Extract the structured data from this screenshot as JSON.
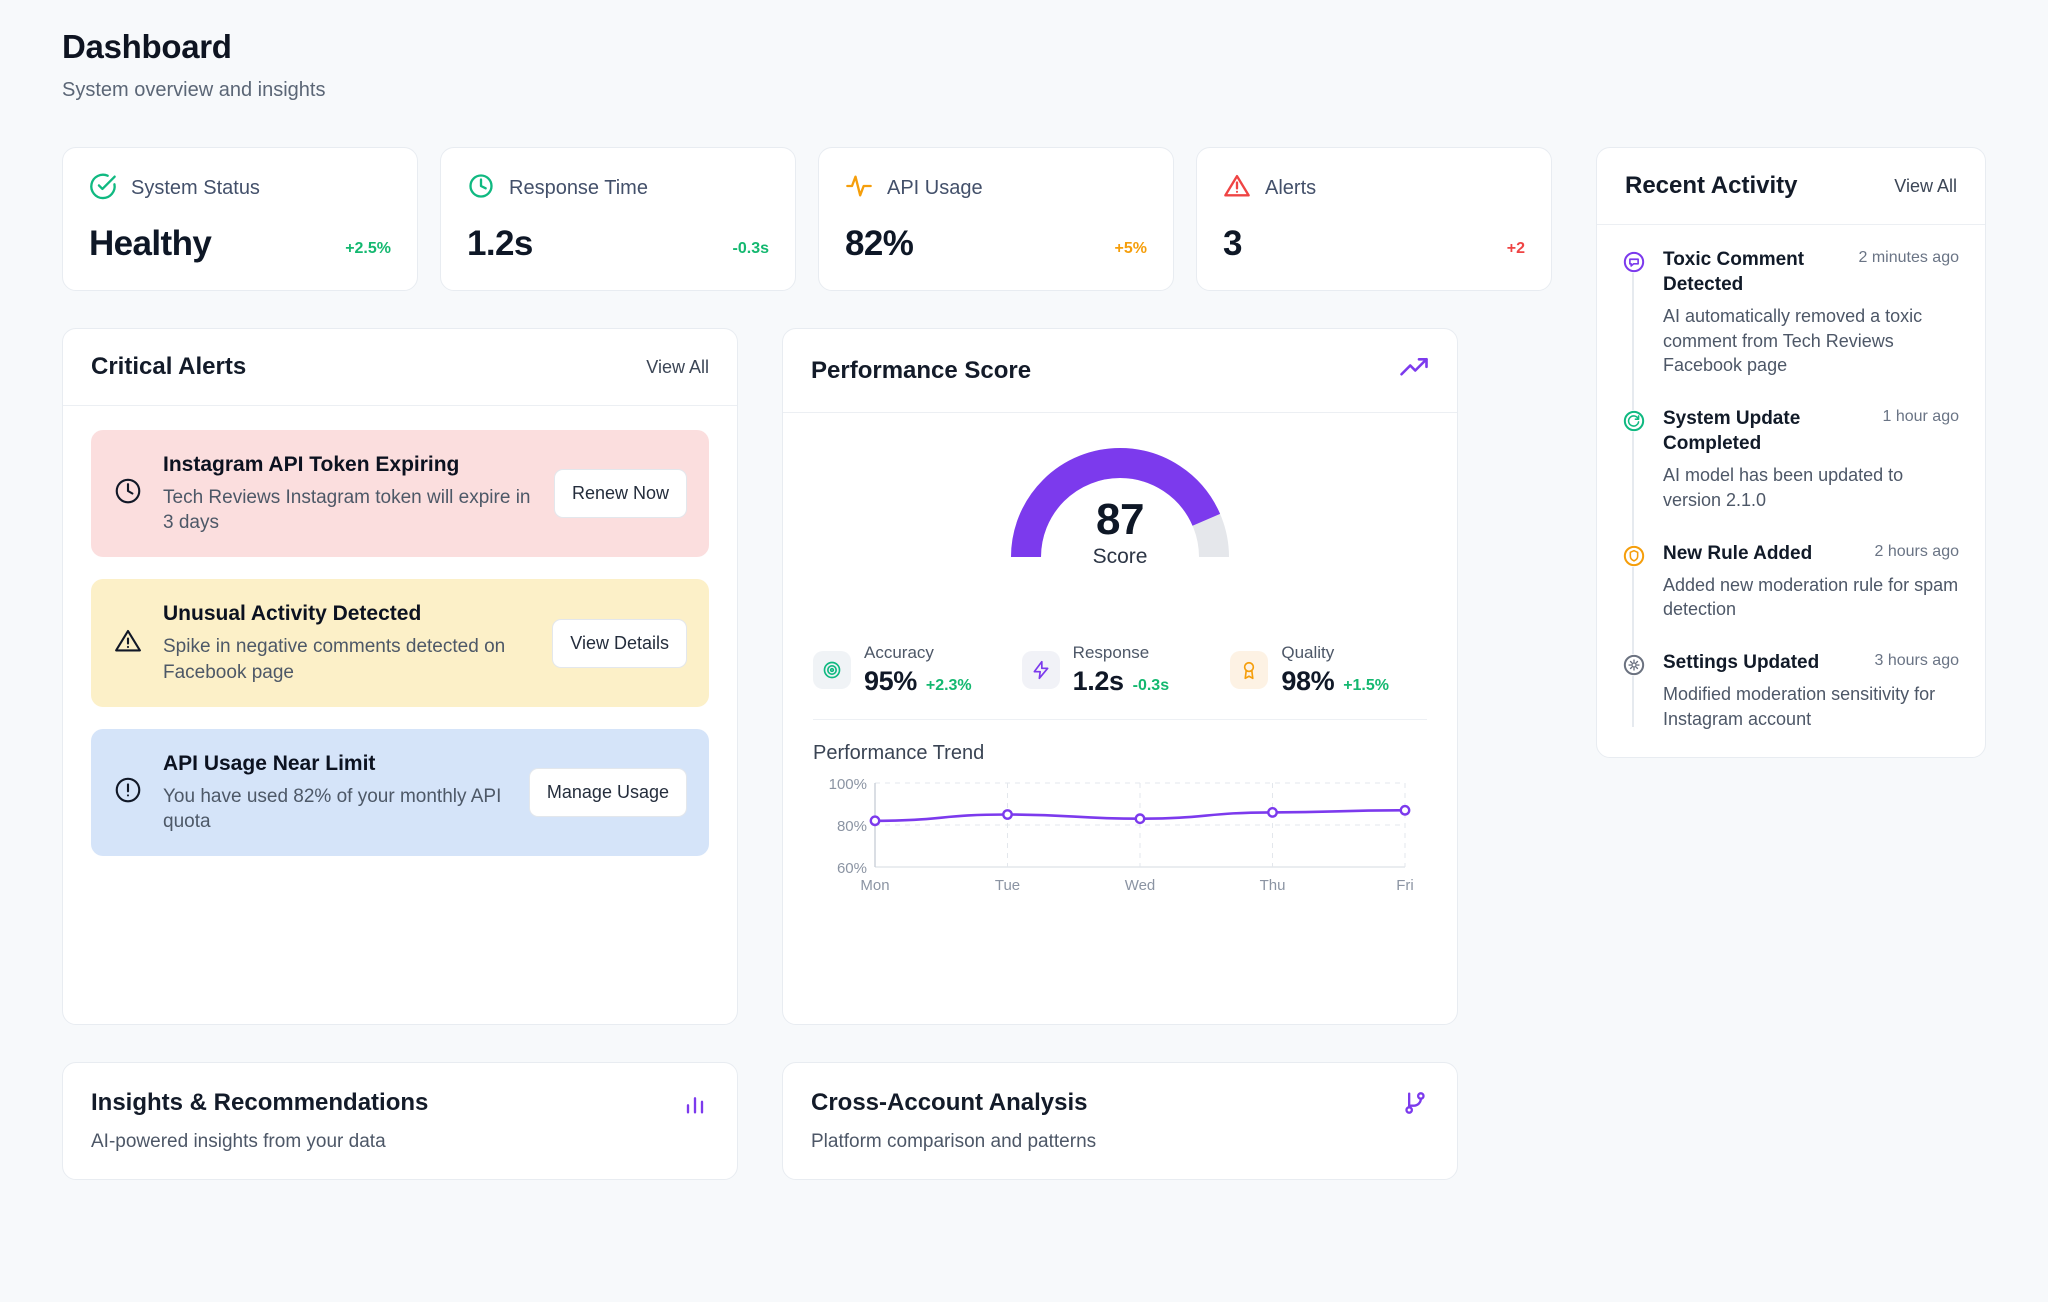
{
  "header": {
    "title": "Dashboard",
    "subtitle": "System overview and insights"
  },
  "stats": [
    {
      "icon": "check-circle-icon",
      "label": "System Status",
      "value": "Healthy",
      "delta": "+2.5%",
      "delta_color": "#14b870",
      "icon_color": "#10b981"
    },
    {
      "icon": "clock-icon",
      "label": "Response Time",
      "value": "1.2s",
      "delta": "-0.3s",
      "delta_color": "#14b870",
      "icon_color": "#10b981"
    },
    {
      "icon": "activity-icon",
      "label": "API Usage",
      "value": "82%",
      "delta": "+5%",
      "delta_color": "#f59e0b",
      "icon_color": "#f59e0b"
    },
    {
      "icon": "alert-triangle-icon",
      "label": "Alerts",
      "value": "3",
      "delta": "+2",
      "delta_color": "#ef4444",
      "icon_color": "#ef4444"
    }
  ],
  "critical_alerts": {
    "title": "Critical Alerts",
    "view_all": "View All",
    "items": [
      {
        "icon": "clock-icon",
        "tone": "red",
        "title": "Instagram API Token Expiring",
        "desc": "Tech Reviews Instagram token will expire in 3 days",
        "action": "Renew Now"
      },
      {
        "icon": "alert-triangle-icon",
        "tone": "yellow",
        "title": "Unusual Activity Detected",
        "desc": "Spike in negative comments detected on Facebook page",
        "action": "View Details"
      },
      {
        "icon": "alert-circle-icon",
        "tone": "blue",
        "title": "API Usage Near Limit",
        "desc": "You have used 82% of your monthly API quota",
        "action": "Manage Usage"
      }
    ]
  },
  "performance": {
    "title": "Performance Score",
    "header_icon": "trending-up-icon",
    "gauge": {
      "score": "87",
      "caption": "Score",
      "percent": 87,
      "fill_color": "#7c3aed",
      "track_color": "#e5e7eb"
    },
    "metrics": [
      {
        "icon": "target-icon",
        "label": "Accuracy",
        "value": "95%",
        "delta": "+2.3%",
        "icon_color": "#10b981",
        "icon_bg": "#f0f3f6"
      },
      {
        "icon": "zap-icon",
        "label": "Response",
        "value": "1.2s",
        "delta": "-0.3s",
        "icon_color": "#7c3aed",
        "icon_bg": "#f1f2f7"
      },
      {
        "icon": "award-icon",
        "label": "Quality",
        "value": "98%",
        "delta": "+1.5%",
        "icon_color": "#f59e0b",
        "icon_bg": "#fdf2e4"
      }
    ],
    "trend_title": "Performance Trend"
  },
  "chart_data": {
    "type": "line",
    "title": "Performance Trend",
    "categories": [
      "Mon",
      "Tue",
      "Wed",
      "Thu",
      "Fri"
    ],
    "values": [
      82,
      85,
      83,
      86,
      87
    ],
    "ytick_labels": [
      "100%",
      "80%",
      "60%"
    ],
    "yticks": [
      100,
      80,
      60
    ],
    "ylim": [
      60,
      100
    ],
    "xlabel": "",
    "ylabel": "",
    "grid": true,
    "legend": false,
    "line_color": "#7c3aed",
    "marker": "circle-open"
  },
  "recent_activity": {
    "title": "Recent Activity",
    "view_all": "View All",
    "items": [
      {
        "icon": "message-circle-icon",
        "icon_color": "#7c3aed",
        "title": "Toxic Comment Detected",
        "time": "2 minutes ago",
        "desc": "AI automatically removed a toxic comment from Tech Reviews Facebook page"
      },
      {
        "icon": "refresh-icon",
        "icon_color": "#10b981",
        "title": "System Update Completed",
        "time": "1 hour ago",
        "desc": "AI model has been updated to version 2.1.0"
      },
      {
        "icon": "shield-icon",
        "icon_color": "#f59e0b",
        "title": "New Rule Added",
        "time": "2 hours ago",
        "desc": "Added new moderation rule for spam detection"
      },
      {
        "icon": "gear-icon",
        "icon_color": "#6b7280",
        "title": "Settings Updated",
        "time": "3 hours ago",
        "desc": "Modified moderation sensitivity for Instagram account"
      }
    ]
  },
  "bottom_cards": [
    {
      "title": "Insights & Recommendations",
      "subtitle": "AI-powered insights from your data",
      "icon": "bar-chart-icon",
      "icon_color": "#7c3aed"
    },
    {
      "title": "Cross-Account Analysis",
      "subtitle": "Platform comparison and patterns",
      "icon": "git-branch-icon",
      "icon_color": "#7c3aed"
    }
  ]
}
